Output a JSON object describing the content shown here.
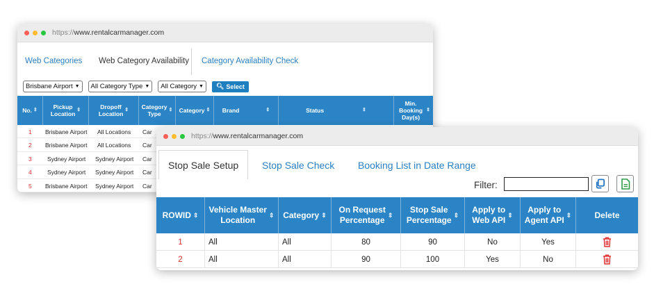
{
  "colors": {
    "accent": "#2b84c6",
    "link": "#2a7fc1",
    "index_red": "#e02b2b",
    "traffic_red": "#ff5f57",
    "traffic_yellow": "#febc2e",
    "traffic_green": "#28c840"
  },
  "back_window": {
    "url_prefix": "https://",
    "url_host": "www.rentalcarmanager.com",
    "tabs": [
      {
        "label": "Web Categories"
      },
      {
        "label": "Web Category Availability"
      },
      {
        "label": "Category Availability Check"
      }
    ],
    "filters": [
      {
        "value": "Brisbane Airport"
      },
      {
        "value": "All Category Type"
      },
      {
        "value": "All Category"
      }
    ],
    "select_button": "Select",
    "columns": [
      {
        "line1": "No.",
        "line2": ""
      },
      {
        "line1": "Pickup",
        "line2": "Location"
      },
      {
        "line1": "Dropoff",
        "line2": "Location"
      },
      {
        "line1": "Category",
        "line2": "Type"
      },
      {
        "line1": "Category",
        "line2": ""
      },
      {
        "line1": "Brand",
        "line2": ""
      },
      {
        "line1": "Status",
        "line2": ""
      },
      {
        "line1": "Min.",
        "line2": "Booking Day(s)"
      }
    ],
    "rows": [
      {
        "no": "1",
        "pickup": "Brisbane Airport",
        "dropoff": "All Locations",
        "type": "Car"
      },
      {
        "no": "2",
        "pickup": "Brisbane Airport",
        "dropoff": "All Locations",
        "type": "Car"
      },
      {
        "no": "3",
        "pickup": "Sydney Airport",
        "dropoff": "Sydney Airport",
        "type": "Car"
      },
      {
        "no": "4",
        "pickup": "Sydney Airport",
        "dropoff": "Sydney Airport",
        "type": "Car"
      },
      {
        "no": "5",
        "pickup": "Brisbane Airport",
        "dropoff": "Sydney Airport",
        "type": "Car"
      }
    ]
  },
  "front_window": {
    "url_prefix": "https://",
    "url_host": "www.rentalcarmanager.com",
    "tabs": [
      {
        "label": "Stop Sale Setup",
        "active": true
      },
      {
        "label": "Stop Sale Check",
        "active": false
      },
      {
        "label": "Booking List in Date Range",
        "active": false
      }
    ],
    "filter_label": "Filter:",
    "filter_value": "",
    "columns": [
      {
        "line1": "ROWID",
        "line2": ""
      },
      {
        "line1": "Vehicle Master",
        "line2": "Location"
      },
      {
        "line1": "Category",
        "line2": ""
      },
      {
        "line1": "On Request",
        "line2": "Percentage"
      },
      {
        "line1": "Stop Sale",
        "line2": "Percentage"
      },
      {
        "line1": "Apply to",
        "line2": "Web API"
      },
      {
        "line1": "Apply to",
        "line2": "Agent API"
      },
      {
        "line1": "Delete",
        "line2": ""
      }
    ],
    "rows": [
      {
        "rowid": "1",
        "location": "All",
        "category": "All",
        "on_request": "80",
        "stop_sale": "90",
        "web_api": "No",
        "agent_api": "Yes"
      },
      {
        "rowid": "2",
        "location": "All",
        "category": "All",
        "on_request": "90",
        "stop_sale": "100",
        "web_api": "Yes",
        "agent_api": "No"
      }
    ]
  }
}
